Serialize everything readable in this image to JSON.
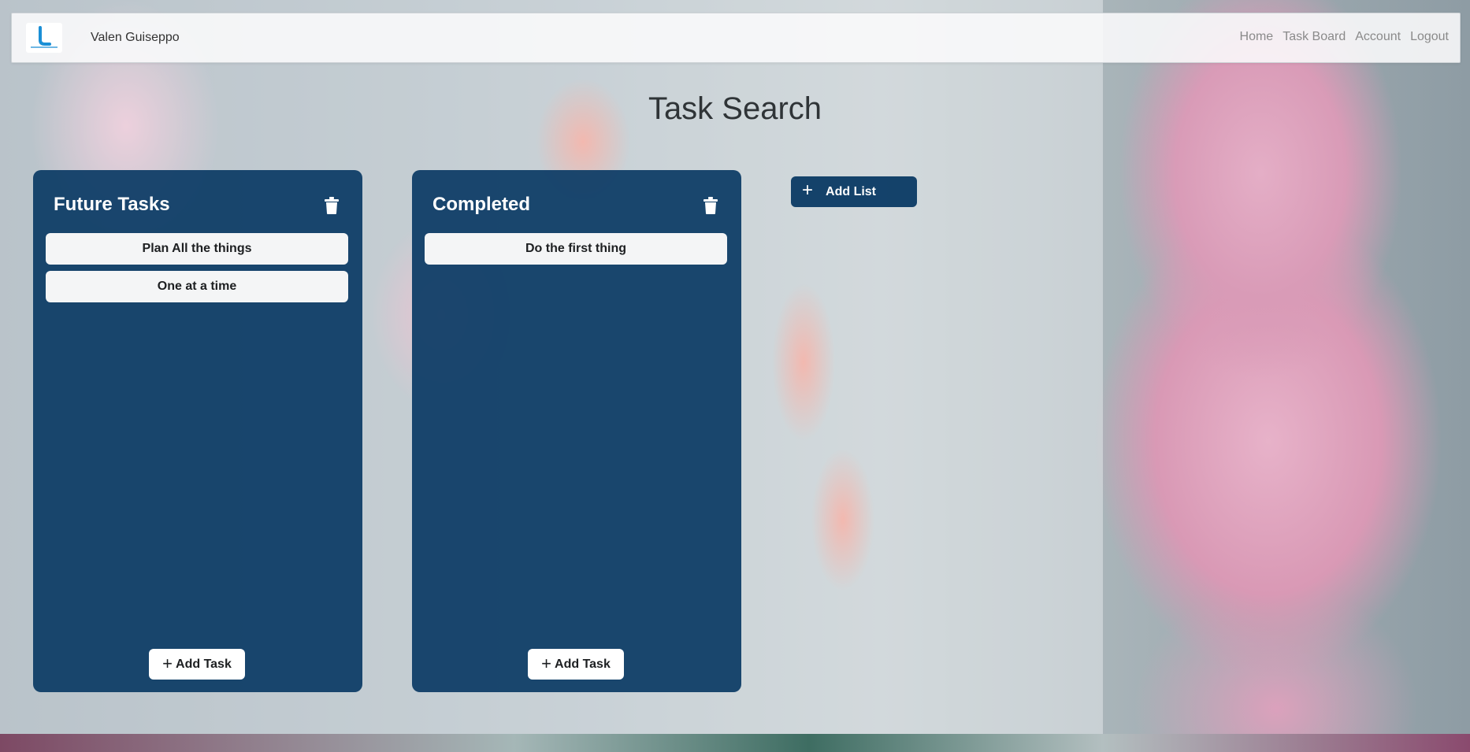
{
  "navbar": {
    "user_name": "Valen Guiseppo",
    "links": [
      "Home",
      "Task Board",
      "Account",
      "Logout"
    ]
  },
  "page": {
    "title": "Task Search"
  },
  "lists": [
    {
      "title": "Future Tasks",
      "tasks": [
        "Plan All the things",
        "One at a time"
      ],
      "add_task_label": "Add Task"
    },
    {
      "title": "Completed",
      "tasks": [
        "Do the first thing"
      ],
      "add_task_label": "Add Task"
    }
  ],
  "add_list_label": "Add List",
  "icons": {
    "logo": "taskmaster-logo",
    "delete": "trash-icon",
    "add": "plus-icon"
  },
  "colors": {
    "list_background": "#0a3a64",
    "card_background": "#f4f5f6",
    "nav_link": "#8a8a8a"
  }
}
